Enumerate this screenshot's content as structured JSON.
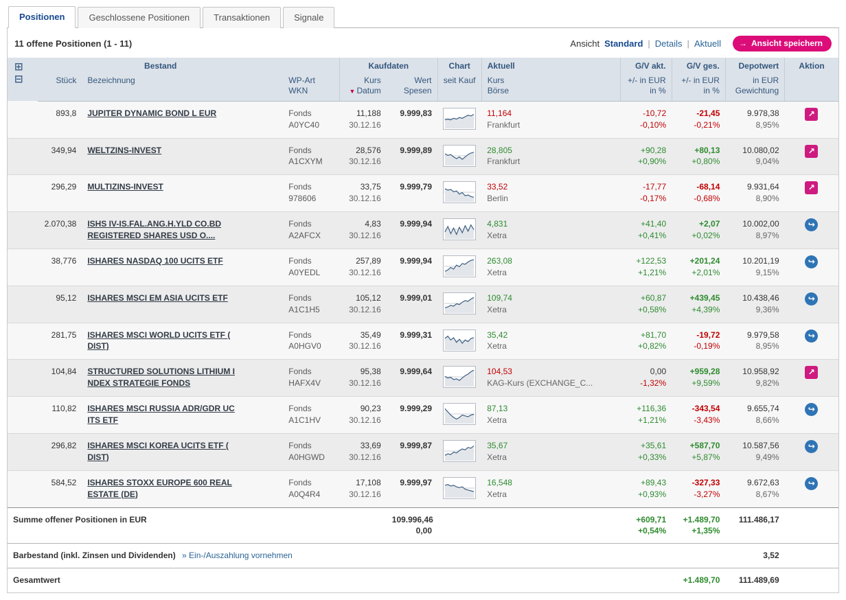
{
  "tabs": [
    {
      "label": "Positionen",
      "active": true
    },
    {
      "label": "Geschlossene Positionen",
      "active": false
    },
    {
      "label": "Transaktionen",
      "active": false
    },
    {
      "label": "Signale",
      "active": false
    }
  ],
  "toolbar": {
    "positions_count": "11 offene Positionen (1 - 11)",
    "view_label": "Ansicht",
    "views": [
      "Standard",
      "Details",
      "Aktuell"
    ],
    "save_view_button": "Ansicht speichern",
    "save_view_arrow": "→"
  },
  "colors": {
    "accent_magenta": "#dc0c79",
    "negative": "#c00000",
    "positive": "#2e8b2e",
    "header_bg": "#dce2e9",
    "header_text": "#33567d"
  },
  "table": {
    "header": {
      "bestand": "Bestand",
      "stueck": "Stück",
      "bezeichnung": "Bezeichnung",
      "wp_art": "WP-Art",
      "wkn": "WKN",
      "kaufdaten": "Kaufdaten",
      "kurs": "Kurs",
      "datum": "Datum",
      "wert": "Wert",
      "spesen": "Spesen",
      "chart": "Chart",
      "seit_kauf": "seit Kauf",
      "aktuell": "Aktuell",
      "aktuell_kurs": "Kurs",
      "boerse": "Börse",
      "gv_akt": "G/V akt.",
      "gv_ges": "G/V ges.",
      "plusminus_eur": "+/- in EUR",
      "in_pct": "in %",
      "depotwert": "Depotwert",
      "in_eur": "in EUR",
      "gewichtung": "Gewichtung",
      "aktion": "Aktion"
    },
    "rows": [
      {
        "stueck": "893,8",
        "name": [
          "JUPITER DYNAMIC BOND L EUR"
        ],
        "wp_art": "Fonds",
        "wkn": "A0YC40",
        "kurs": "11,188",
        "datum": "30.12.16",
        "wert": "9.999,83",
        "akt_kurs": "11,164",
        "akt_cls": "neg",
        "boerse": "Frankfurt",
        "gv_akt": [
          "-10,72",
          "-0,10%"
        ],
        "gv_akt_cls": [
          "neg",
          "neg"
        ],
        "gv_ges": [
          "-21,45",
          "-0,21%"
        ],
        "gv_ges_cls": [
          "neg",
          "neg"
        ],
        "depotwert": "9.978,38",
        "gewichtung": "8,95%",
        "aktion": "magenta",
        "spark": [
          9,
          10,
          9,
          11,
          10,
          12,
          11,
          13,
          15,
          14,
          16
        ]
      },
      {
        "stueck": "349,94",
        "name": [
          "WELTZINS-INVEST"
        ],
        "wp_art": "Fonds",
        "wkn": "A1CXYM",
        "kurs": "28,576",
        "datum": "30.12.16",
        "wert": "9.999,89",
        "akt_kurs": "28,805",
        "akt_cls": "pos",
        "boerse": "Frankfurt",
        "gv_akt": [
          "+90,28",
          "+0,90%"
        ],
        "gv_akt_cls": [
          "pos",
          "pos"
        ],
        "gv_ges": [
          "+80,13",
          "+0,80%"
        ],
        "gv_ges_cls": [
          "pos",
          "pos"
        ],
        "depotwert": "10.080,02",
        "gewichtung": "9,04%",
        "aktion": "magenta",
        "spark": [
          13,
          11,
          12,
          9,
          7,
          9,
          6,
          9,
          12,
          14,
          15
        ]
      },
      {
        "stueck": "296,29",
        "name": [
          "MULTIZINS-INVEST"
        ],
        "wp_art": "Fonds",
        "wkn": "978606",
        "kurs": "33,75",
        "datum": "30.12.16",
        "wert": "9.999,79",
        "akt_kurs": "33,52",
        "akt_cls": "neg",
        "boerse": "Berlin",
        "gv_akt": [
          "-17,77",
          "-0,17%"
        ],
        "gv_akt_cls": [
          "neg",
          "neg"
        ],
        "gv_ges": [
          "-68,14",
          "-0,68%"
        ],
        "gv_ges_cls": [
          "neg",
          "neg"
        ],
        "depotwert": "9.931,64",
        "gewichtung": "8,90%",
        "aktion": "magenta",
        "spark": [
          15,
          13,
          14,
          11,
          12,
          8,
          10,
          6,
          7,
          5,
          4
        ]
      },
      {
        "stueck": "2.070,38",
        "name": [
          "ISHS IV-IS.FAL.ANG.H.YLD CO.BD",
          "REGISTERED SHARES USD O...."
        ],
        "wp_art": "Fonds",
        "wkn": "A2AFCX",
        "kurs": "4,83",
        "datum": "30.12.16",
        "wert": "9.999,94",
        "akt_kurs": "4,831",
        "akt_cls": "pos",
        "boerse": "Xetra",
        "gv_akt": [
          "+41,40",
          "+0,41%"
        ],
        "gv_akt_cls": [
          "pos",
          "pos"
        ],
        "gv_ges": [
          "+2,07",
          "+0,02%"
        ],
        "gv_ges_cls": [
          "pos",
          "pos"
        ],
        "depotwert": "10.002,00",
        "gewichtung": "8,97%",
        "aktion": "blue",
        "spark": [
          7,
          14,
          5,
          12,
          4,
          13,
          6,
          15,
          8,
          16,
          10
        ]
      },
      {
        "stueck": "38,776",
        "name": [
          "ISHARES NASDAQ 100 UCITS ETF"
        ],
        "wp_art": "Fonds",
        "wkn": "A0YEDL",
        "kurs": "257,89",
        "datum": "30.12.16",
        "wert": "9.999,94",
        "akt_kurs": "263,08",
        "akt_cls": "pos",
        "boerse": "Xetra",
        "gv_akt": [
          "+122,53",
          "+1,21%"
        ],
        "gv_akt_cls": [
          "pos",
          "pos"
        ],
        "gv_ges": [
          "+201,24",
          "+2,01%"
        ],
        "gv_ges_cls": [
          "pos",
          "pos"
        ],
        "depotwert": "10.201,19",
        "gewichtung": "9,15%",
        "aktion": "blue",
        "spark": [
          4,
          6,
          9,
          7,
          12,
          10,
          14,
          13,
          16,
          18,
          19
        ]
      },
      {
        "stueck": "95,12",
        "name": [
          "ISHARES MSCI EM ASIA UCITS ETF"
        ],
        "wp_art": "Fonds",
        "wkn": "A1C1H5",
        "kurs": "105,12",
        "datum": "30.12.16",
        "wert": "9.999,01",
        "akt_kurs": "109,74",
        "akt_cls": "pos",
        "boerse": "Xetra",
        "gv_akt": [
          "+60,87",
          "+0,58%"
        ],
        "gv_akt_cls": [
          "pos",
          "pos"
        ],
        "gv_ges": [
          "+439,45",
          "+4,39%"
        ],
        "gv_ges_cls": [
          "pos",
          "pos"
        ],
        "depotwert": "10.438,46",
        "gewichtung": "9,36%",
        "aktion": "blue",
        "spark": [
          5,
          6,
          8,
          7,
          10,
          9,
          12,
          14,
          13,
          16,
          18
        ]
      },
      {
        "stueck": "281,75",
        "name": [
          "ISHARES MSCI WORLD UCITS ETF (",
          "DIST)"
        ],
        "wp_art": "Fonds",
        "wkn": "A0HGV0",
        "kurs": "35,49",
        "datum": "30.12.16",
        "wert": "9.999,31",
        "akt_kurs": "35,42",
        "akt_cls": "pos",
        "boerse": "Xetra",
        "gv_akt": [
          "+81,70",
          "+0,82%"
        ],
        "gv_akt_cls": [
          "pos",
          "pos"
        ],
        "gv_ges": [
          "-19,72",
          "-0,19%"
        ],
        "gv_ges_cls": [
          "neg",
          "neg"
        ],
        "depotwert": "9.979,58",
        "gewichtung": "8,95%",
        "aktion": "blue",
        "spark": [
          13,
          16,
          11,
          14,
          8,
          12,
          7,
          11,
          9,
          13,
          14
        ]
      },
      {
        "stueck": "104,84",
        "name": [
          "STRUCTURED SOLUTIONS LITHIUM I",
          "NDEX STRATEGIE FONDS"
        ],
        "wp_art": "Fonds",
        "wkn": "HAFX4V",
        "kurs": "95,38",
        "datum": "30.12.16",
        "wert": "9.999,64",
        "akt_kurs": "104,53",
        "akt_cls": "neg",
        "boerse": "KAG-Kurs (EXCHANGE_C...",
        "gv_akt": [
          "0,00",
          "-1,32%"
        ],
        "gv_akt_cls": [
          "neutral",
          "neg"
        ],
        "gv_ges": [
          "+959,28",
          "+9,59%"
        ],
        "gv_ges_cls": [
          "pos",
          "pos"
        ],
        "depotwert": "10.958,92",
        "gewichtung": "9,82%",
        "aktion": "magenta",
        "spark": [
          11,
          9,
          10,
          7,
          8,
          6,
          9,
          12,
          14,
          17,
          19
        ]
      },
      {
        "stueck": "110,82",
        "name": [
          "ISHARES MSCI RUSSIA ADR/GDR UC",
          "ITS ETF"
        ],
        "wp_art": "Fonds",
        "wkn": "A1C1HV",
        "kurs": "90,23",
        "datum": "30.12.16",
        "wert": "9.999,29",
        "akt_kurs": "87,13",
        "akt_cls": "pos",
        "boerse": "Xetra",
        "gv_akt": [
          "+116,36",
          "+1,21%"
        ],
        "gv_akt_cls": [
          "pos",
          "pos"
        ],
        "gv_ges": [
          "-343,54",
          "-3,43%"
        ],
        "gv_ges_cls": [
          "neg",
          "neg"
        ],
        "depotwert": "9.655,74",
        "gewichtung": "8,66%",
        "aktion": "blue",
        "spark": [
          17,
          13,
          9,
          6,
          4,
          6,
          9,
          8,
          7,
          9,
          10
        ]
      },
      {
        "stueck": "296,82",
        "name": [
          "ISHARES MSCI KOREA UCITS ETF (",
          "DIST)"
        ],
        "wp_art": "Fonds",
        "wkn": "A0HGWD",
        "kurs": "33,69",
        "datum": "30.12.16",
        "wert": "9.999,87",
        "akt_kurs": "35,67",
        "akt_cls": "pos",
        "boerse": "Xetra",
        "gv_akt": [
          "+35,61",
          "+0,33%"
        ],
        "gv_akt_cls": [
          "pos",
          "pos"
        ],
        "gv_ges": [
          "+587,70",
          "+5,87%"
        ],
        "gv_ges_cls": [
          "pos",
          "pos"
        ],
        "depotwert": "10.587,56",
        "gewichtung": "9,49%",
        "aktion": "blue",
        "spark": [
          5,
          7,
          6,
          9,
          8,
          11,
          13,
          12,
          15,
          14,
          17
        ]
      },
      {
        "stueck": "584,52",
        "name": [
          "ISHARES STOXX EUROPE 600 REAL",
          "ESTATE (DE)"
        ],
        "wp_art": "Fonds",
        "wkn": "A0Q4R4",
        "kurs": "17,108",
        "datum": "30.12.16",
        "wert": "9.999,97",
        "akt_kurs": "16,548",
        "akt_cls": "pos",
        "boerse": "Xetra",
        "gv_akt": [
          "+89,43",
          "+0,93%"
        ],
        "gv_akt_cls": [
          "pos",
          "pos"
        ],
        "gv_ges": [
          "-327,33",
          "-3,27%"
        ],
        "gv_ges_cls": [
          "neg",
          "neg"
        ],
        "depotwert": "9.672,63",
        "gewichtung": "8,67%",
        "aktion": "blue",
        "spark": [
          14,
          15,
          13,
          14,
          12,
          11,
          12,
          9,
          8,
          7,
          6
        ]
      }
    ]
  },
  "footer": {
    "summe_label": "Summe offener Positionen in EUR",
    "summe_wert": "109.996,46",
    "summe_spesen": "0,00",
    "summe_gv_akt_eur": "+609,71",
    "summe_gv_akt_pct": "+0,54%",
    "summe_gv_ges_eur": "+1.489,70",
    "summe_gv_ges_pct": "+1,35%",
    "summe_depotwert": "111.486,17",
    "barbestand_label": "Barbestand (inkl. Zinsen und Dividenden)",
    "barbestand_link": "» Ein-/Auszahlung vornehmen",
    "barbestand_value": "3,52",
    "gesamtwert_label": "Gesamtwert",
    "gesamtwert_gv": "+1.489,70",
    "gesamtwert_value": "111.489,69"
  }
}
